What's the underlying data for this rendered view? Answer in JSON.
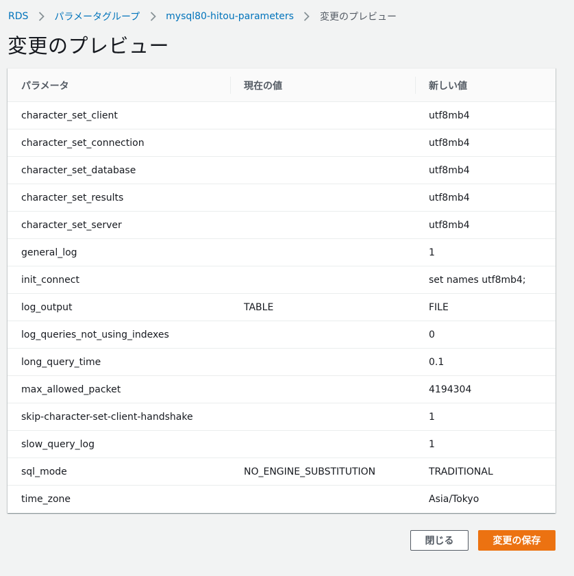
{
  "breadcrumb": {
    "items": [
      {
        "label": "RDS"
      },
      {
        "label": "パラメータグループ"
      },
      {
        "label": "mysql80-hitou-parameters"
      },
      {
        "label": "変更のプレビュー"
      }
    ]
  },
  "page": {
    "title": "変更のプレビュー"
  },
  "table": {
    "headers": [
      "パラメータ",
      "現在の値",
      "新しい値"
    ],
    "rows": [
      {
        "param": "character_set_client",
        "current": "",
        "new": "utf8mb4"
      },
      {
        "param": "character_set_connection",
        "current": "",
        "new": "utf8mb4"
      },
      {
        "param": "character_set_database",
        "current": "",
        "new": "utf8mb4"
      },
      {
        "param": "character_set_results",
        "current": "",
        "new": "utf8mb4"
      },
      {
        "param": "character_set_server",
        "current": "",
        "new": "utf8mb4"
      },
      {
        "param": "general_log",
        "current": "",
        "new": "1"
      },
      {
        "param": "init_connect",
        "current": "",
        "new": "set names utf8mb4;"
      },
      {
        "param": "log_output",
        "current": "TABLE",
        "new": "FILE"
      },
      {
        "param": "log_queries_not_using_indexes",
        "current": "",
        "new": "0"
      },
      {
        "param": "long_query_time",
        "current": "",
        "new": "0.1"
      },
      {
        "param": "max_allowed_packet",
        "current": "",
        "new": "4194304"
      },
      {
        "param": "skip-character-set-client-handshake",
        "current": "",
        "new": "1"
      },
      {
        "param": "slow_query_log",
        "current": "",
        "new": "1"
      },
      {
        "param": "sql_mode",
        "current": "NO_ENGINE_SUBSTITUTION",
        "new": "TRADITIONAL"
      },
      {
        "param": "time_zone",
        "current": "",
        "new": "Asia/Tokyo"
      }
    ]
  },
  "actions": {
    "close_label": "閉じる",
    "save_label": "変更の保存"
  },
  "colors": {
    "link": "#0073bb",
    "primary_button": "#ec7211",
    "background": "#f2f3f3"
  }
}
